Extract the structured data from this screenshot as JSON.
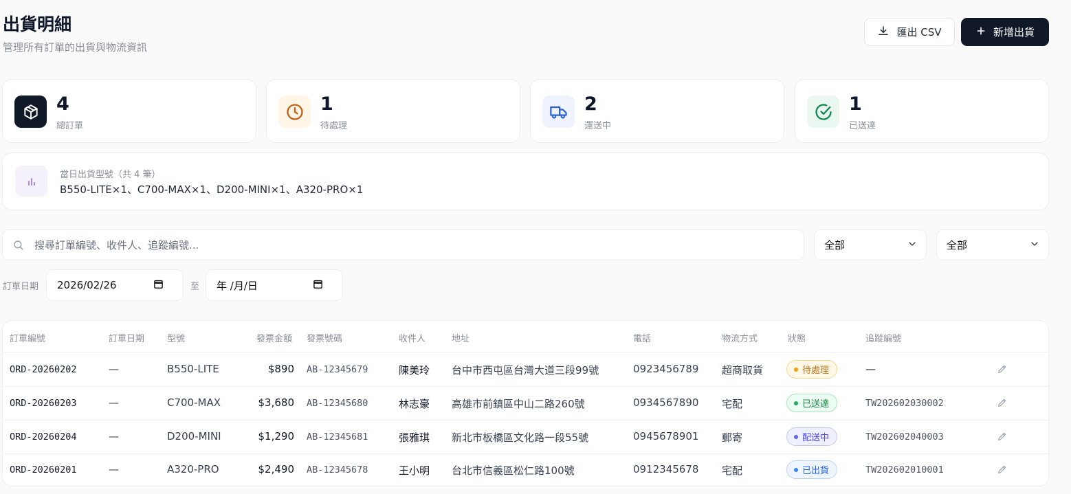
{
  "header": {
    "title": "出貨明細",
    "subtitle": "管理所有訂單的出貨與物流資訊",
    "export_label": "匯出 CSV",
    "new_label": "新增出貨"
  },
  "stats": [
    {
      "value": "4",
      "label": "總訂單",
      "icon": "package-icon"
    },
    {
      "value": "1",
      "label": "待處理",
      "icon": "clock-icon"
    },
    {
      "value": "2",
      "label": "運送中",
      "icon": "truck-icon"
    },
    {
      "value": "1",
      "label": "已送達",
      "icon": "check-circle-icon"
    }
  ],
  "models": {
    "caption": "當日出貨型號（共 4 筆）",
    "value": "B550-LITE×1、C700-MAX×1、D200-MINI×1、A320-PRO×1",
    "icon": "bar-chart-icon"
  },
  "search": {
    "placeholder": "搜尋訂單編號、收件人、追蹤編號..."
  },
  "filters": {
    "status": "全部",
    "method": "全部"
  },
  "date_filter": {
    "label": "訂單日期",
    "from": "2026/02/26",
    "separator": "至",
    "to": "年 /月/日"
  },
  "table": {
    "headers": [
      "訂單編號",
      "訂單日期",
      "型號",
      "發票金額",
      "發票號碼",
      "收件人",
      "地址",
      "電話",
      "物流方式",
      "狀態",
      "追蹤編號"
    ],
    "rows": [
      {
        "order": "ORD-20260202",
        "date": "—",
        "model": "B550-LITE",
        "amount": "$890",
        "invoice": "AB-12345679",
        "recipient": "陳美玲",
        "address": "台中市西屯區台灣大道三段99號",
        "phone": "0923456789",
        "method": "超商取貨",
        "status": "待處理",
        "tracking": "—"
      },
      {
        "order": "ORD-20260203",
        "date": "—",
        "model": "C700-MAX",
        "amount": "$3,680",
        "invoice": "AB-12345680",
        "recipient": "林志豪",
        "address": "高雄市前鎮區中山二路260號",
        "phone": "0934567890",
        "method": "宅配",
        "status": "已送達",
        "tracking": "TW202602030002"
      },
      {
        "order": "ORD-20260204",
        "date": "—",
        "model": "D200-MINI",
        "amount": "$1,290",
        "invoice": "AB-12345681",
        "recipient": "張雅琪",
        "address": "新北市板橋區文化路一段55號",
        "phone": "0945678901",
        "method": "郵寄",
        "status": "配送中",
        "tracking": "TW202602040003"
      },
      {
        "order": "ORD-20260201",
        "date": "—",
        "model": "A320-PRO",
        "amount": "$2,490",
        "invoice": "AB-12345678",
        "recipient": "王小明",
        "address": "台北市信義區松仁路100號",
        "phone": "0912345678",
        "method": "宅配",
        "status": "已出貨",
        "tracking": "TW202602010001"
      }
    ]
  },
  "status_colors": {
    "待處理": {
      "bg": "#fff8e6",
      "border": "#f6d68a",
      "text": "#b7791f",
      "dot": "#f59e0b"
    },
    "已送達": {
      "bg": "#ecfdf3",
      "border": "#a7e3c3",
      "text": "#15803d",
      "dot": "#22a55a"
    },
    "配送中": {
      "bg": "#eef0ff",
      "border": "#c3c8f5",
      "text": "#4f46e5",
      "dot": "#6366f1"
    },
    "已出貨": {
      "bg": "#eef5ff",
      "border": "#bcd4f5",
      "text": "#2563eb",
      "dot": "#3b82f6"
    }
  }
}
